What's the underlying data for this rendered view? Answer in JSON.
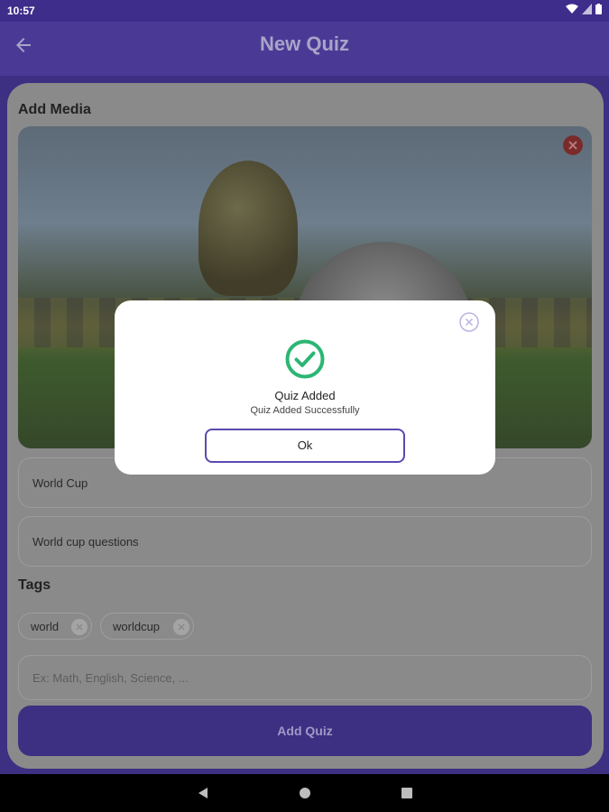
{
  "status_bar": {
    "time": "10:57",
    "icons": [
      "wifi-icon",
      "signal-icon",
      "battery-icon"
    ]
  },
  "app_bar": {
    "title": "New Quiz",
    "back_icon": "arrow-left-icon"
  },
  "form": {
    "add_media_label": "Add Media",
    "quiz_title_value": "World Cup",
    "quiz_description_value": "World cup questions",
    "tags_label": "Tags",
    "tags": [
      {
        "label": "world"
      },
      {
        "label": "worldcup"
      }
    ],
    "tag_input_placeholder": "Ex: Math, English, Science, ...",
    "submit_label": "Add Quiz"
  },
  "dialog": {
    "title": "Quiz Added",
    "message": "Quiz Added Successfully",
    "ok_label": "Ok",
    "icon": "check-circle-icon"
  },
  "colors": {
    "primary": "#4a3a95",
    "success": "#2bb673",
    "dialog_border": "#5a4ab0"
  }
}
